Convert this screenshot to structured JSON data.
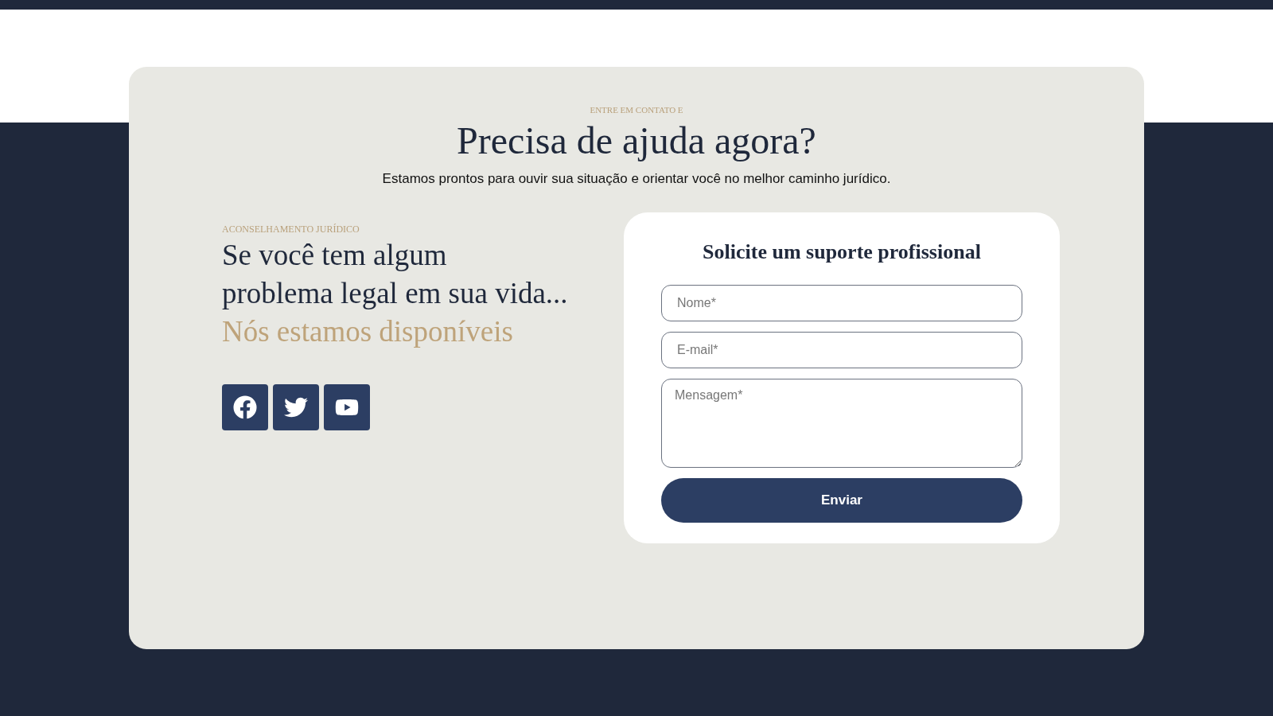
{
  "header": {
    "eyebrow": "ENTRE EM CONTATO E",
    "title": "Precisa de ajuda agora?",
    "subtitle": "Estamos prontos para ouvir sua situação e orientar você no melhor caminho jurídico."
  },
  "intro": {
    "eyebrow": "ACONSELHAMENTO JURÍDICO",
    "lines": [
      "Se você tem algum",
      "problema legal em sua vida..."
    ],
    "highlight": "Nós estamos disponíveis"
  },
  "social": [
    {
      "kind": "facebook"
    },
    {
      "kind": "twitter"
    },
    {
      "kind": "youtube"
    }
  ],
  "form": {
    "title": "Solicite um suporte profissional",
    "fields": [
      {
        "kind": "input",
        "placeholder": "Nome*"
      },
      {
        "kind": "input",
        "placeholder": "E-mail*"
      },
      {
        "kind": "textarea",
        "placeholder": "Mensagem*"
      }
    ],
    "submit": "Enviar"
  }
}
